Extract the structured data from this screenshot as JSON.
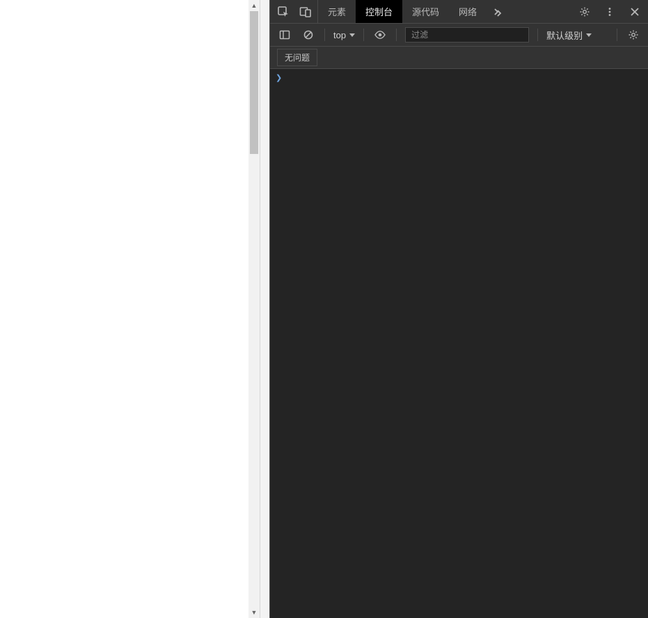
{
  "tabs": {
    "elements": "元素",
    "console": "控制台",
    "sources": "源代码",
    "network": "网络"
  },
  "toolbar": {
    "context_selected": "top",
    "filter_placeholder": "过滤",
    "level_label": "默认级别"
  },
  "issues": {
    "no_issues_label": "无问题"
  }
}
